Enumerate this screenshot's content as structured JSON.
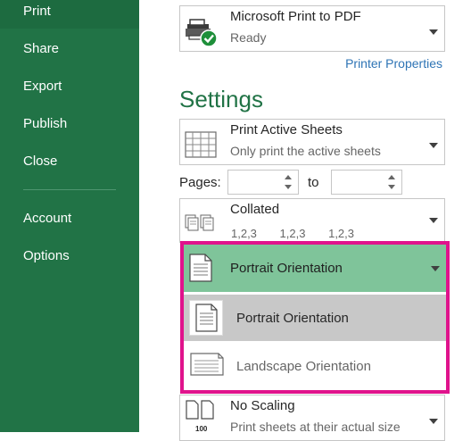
{
  "sidebar": {
    "items": [
      {
        "label": "Print"
      },
      {
        "label": "Share"
      },
      {
        "label": "Export"
      },
      {
        "label": "Publish"
      },
      {
        "label": "Close"
      },
      {
        "label": "Account"
      },
      {
        "label": "Options"
      }
    ]
  },
  "printer": {
    "name": "Microsoft Print to PDF",
    "status": "Ready",
    "properties_link": "Printer Properties"
  },
  "settings": {
    "heading": "Settings",
    "print_what": {
      "title": "Print Active Sheets",
      "subtitle": "Only print the active sheets"
    },
    "pages_label": "Pages:",
    "to_label": "to",
    "pages_from": "",
    "pages_to": "",
    "collation": {
      "title": "Collated",
      "sequence": [
        "1,2,3",
        "1,2,3",
        "1,2,3"
      ]
    },
    "orientation": {
      "selected": "Portrait Orientation",
      "options": [
        "Portrait Orientation",
        "Landscape Orientation"
      ]
    },
    "scaling": {
      "title": "No Scaling",
      "subtitle": "Print sheets at their actual size",
      "icon_text": "100"
    }
  },
  "colors": {
    "sidebar": "#217346",
    "accent_green": "#7fc49a",
    "highlight_frame": "#e0138c",
    "link": "#2e74b5"
  }
}
